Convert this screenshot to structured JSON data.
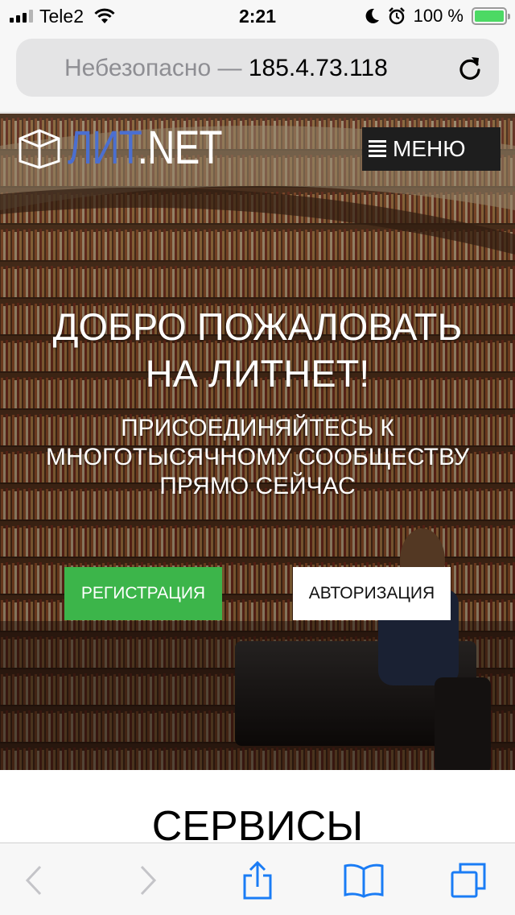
{
  "status_bar": {
    "carrier": "Tele2",
    "time": "2:21",
    "battery_percent": "100 %",
    "battery_level": 1.0,
    "icons": [
      "signal-icon",
      "wifi-icon",
      "moon-icon",
      "alarm-icon",
      "battery-icon"
    ]
  },
  "address_bar": {
    "security": "Небезопасно —",
    "host": "185.4.73.118",
    "reload_icon": "reload-icon"
  },
  "site": {
    "logo": {
      "part1": "ЛИТ",
      "part2": ".NET",
      "icon": "book-icon",
      "colors": {
        "lit": "#4b6fd0",
        "net": "#ffffff"
      }
    },
    "menu": {
      "icon": "hamburger-icon",
      "label": "МЕНЮ"
    }
  },
  "hero": {
    "title_line1": "ДОБРО ПОЖАЛОВАТЬ",
    "title_line2": "НА ЛИТНЕТ!",
    "subtitle_line1": "ПРИСОЕДИНЯЙТЕСЬ К",
    "subtitle_line2": "МНОГОТЫСЯЧНОМУ СООБЩЕСТВУ",
    "subtitle_line3": "ПРЯМО СЕЙЧАС",
    "register_label": "РЕГИСТРАЦИЯ",
    "login_label": "АВТОРИЗАЦИЯ",
    "colors": {
      "register": "#3cb54a",
      "login": "#ffffff"
    }
  },
  "services": {
    "title": "СЕРВИСЫ"
  },
  "toolbar": {
    "icons": [
      "back-icon",
      "forward-icon",
      "share-icon",
      "bookmarks-icon",
      "tabs-icon"
    ],
    "accent": "#1a7cf5",
    "disabled": "#c4c4c8"
  }
}
